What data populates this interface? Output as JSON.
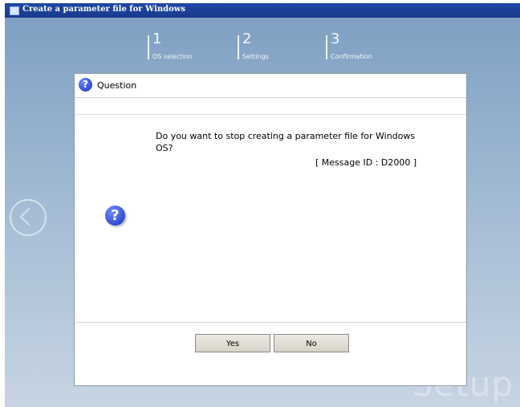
{
  "window": {
    "title": "Create a parameter file for Windows"
  },
  "steps": [
    {
      "number": "1",
      "label": "OS selection"
    },
    {
      "number": "2",
      "label": "Settings"
    },
    {
      "number": "3",
      "label": "Confirmation"
    }
  ],
  "dialog": {
    "title": "Question",
    "message": "Do you want to stop creating a parameter file for Windows OS?",
    "message_id": "[ Message ID : D2000 ]",
    "buttons": {
      "yes": "Yes",
      "no": "No"
    }
  },
  "watermark": "Setup",
  "icons": {
    "title_icon": "window-icon",
    "question_icon": "question-icon",
    "back_icon": "back-arrow-icon"
  }
}
